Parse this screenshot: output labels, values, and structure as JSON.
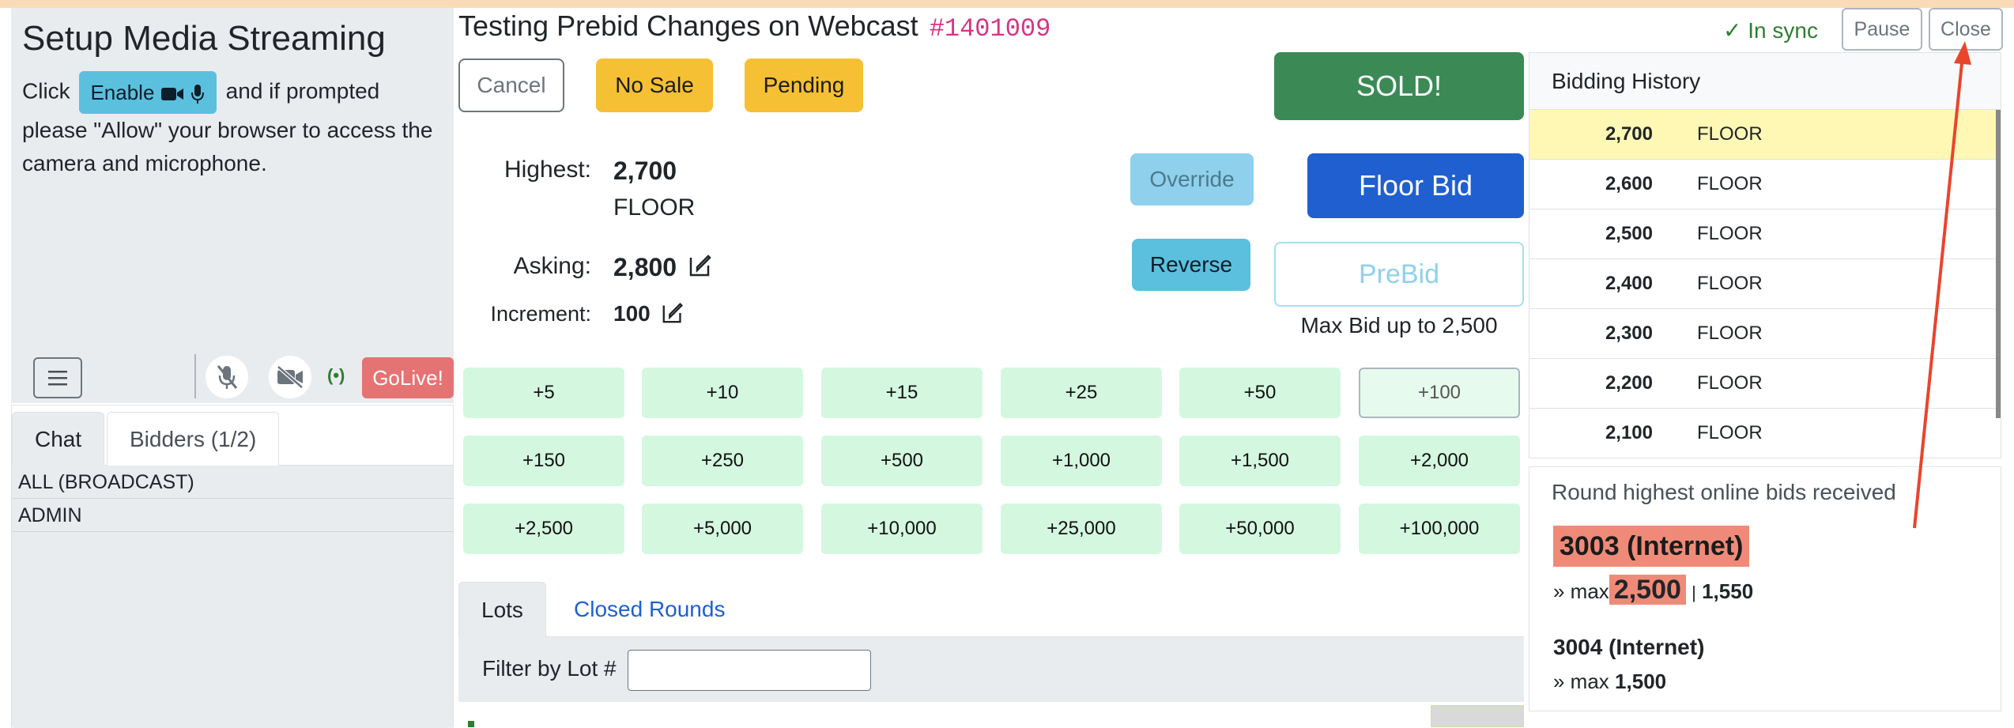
{
  "setup": {
    "title": "Setup Media Streaming",
    "text_before": "Click",
    "enable_label": "Enable",
    "text_after": "and if prompted please \"Allow\" your browser to access the camera and microphone.",
    "golive_label": "GoLive!"
  },
  "chat": {
    "tabs": [
      "Chat",
      "Bidders (1/2)"
    ],
    "rows": [
      "ALL (BROADCAST)",
      "ADMIN"
    ]
  },
  "header": {
    "title": "Testing Prebid Changes on Webcast",
    "code": "#1401009",
    "sync_status": "✓ In sync",
    "pause_label": "Pause",
    "close_label": "Close"
  },
  "actions": {
    "cancel": "Cancel",
    "no_sale": "No Sale",
    "pending": "Pending",
    "sold": "SOLD!",
    "override": "Override",
    "floor_bid": "Floor Bid",
    "reverse": "Reverse",
    "prebid": "PreBid",
    "max_bid_text": "Max Bid up to 2,500"
  },
  "bid": {
    "highest_label": "Highest:",
    "highest_value": "2,700",
    "highest_source": "FLOOR",
    "asking_label": "Asking:",
    "asking_value": "2,800",
    "increment_label": "Increment:",
    "increment_value": "100"
  },
  "increments": [
    "+5",
    "+10",
    "+15",
    "+25",
    "+50",
    "+100",
    "+150",
    "+250",
    "+500",
    "+1,000",
    "+1,500",
    "+2,000",
    "+2,500",
    "+5,000",
    "+10,000",
    "+25,000",
    "+50,000",
    "+100,000"
  ],
  "selected_increment": "+100",
  "lots": {
    "tabs": [
      "Lots",
      "Closed Rounds"
    ],
    "filter_label": "Filter by Lot #"
  },
  "history": {
    "title": "Bidding History",
    "rows": [
      {
        "amount": "2,700",
        "who": "FLOOR"
      },
      {
        "amount": "2,600",
        "who": "FLOOR"
      },
      {
        "amount": "2,500",
        "who": "FLOOR"
      },
      {
        "amount": "2,400",
        "who": "FLOOR"
      },
      {
        "amount": "2,300",
        "who": "FLOOR"
      },
      {
        "amount": "2,200",
        "who": "FLOOR"
      },
      {
        "amount": "2,100",
        "who": "FLOOR"
      }
    ]
  },
  "round": {
    "title": "Round highest online bids received",
    "bidders": [
      {
        "name": "3003 (Internet)",
        "max_prefix": "» max",
        "max": "2,500",
        "extra": "1,550"
      },
      {
        "name": "3004 (Internet)",
        "max_prefix": "» max",
        "max": "1,500"
      }
    ]
  },
  "colors": {
    "accent_red": "#e8452c",
    "sold_green": "#3b8a55",
    "floor_blue": "#1f5fd0"
  }
}
